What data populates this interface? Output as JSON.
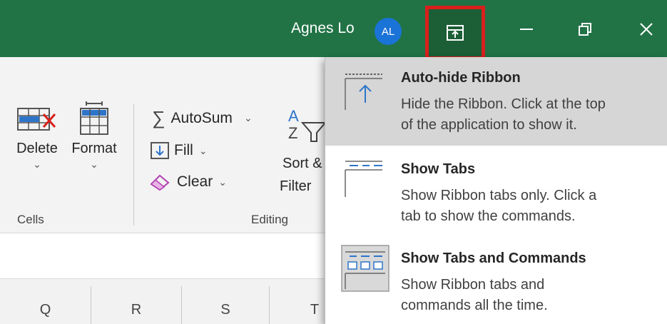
{
  "titlebar": {
    "user_name": "Agnes Lo",
    "avatar_initials": "AL",
    "colors": {
      "bar": "#217346",
      "avatar": "#1a73d6",
      "highlight_border": "#d9201c"
    },
    "icons": {
      "ribbon_options": "ribbon-display-options-icon",
      "minimize": "minimize-icon",
      "restore": "restore-icon",
      "close": "close-icon"
    }
  },
  "ribbon": {
    "cells_group": {
      "label": "Cells",
      "delete_label": "Delete",
      "format_label": "Format",
      "dropdown_glyph": "⌄"
    },
    "editing_group": {
      "label": "Editing",
      "autosum_label": "AutoSum",
      "autosum_glyph": "∑",
      "fill_label": "Fill",
      "clear_label": "Clear",
      "sort_filter_line1": "Sort &",
      "sort_filter_line2": "Filter",
      "caret": "⌄"
    }
  },
  "grid": {
    "columns": [
      "Q",
      "R",
      "S",
      "T"
    ]
  },
  "menu": {
    "items": [
      {
        "title": "Auto-hide Ribbon",
        "desc_line1": "Hide the Ribbon. Click at the top",
        "desc_line2": "of the application to show it.",
        "icon": "auto-hide-ribbon-icon",
        "active": true
      },
      {
        "title": "Show Tabs",
        "desc_line1": "Show Ribbon tabs only. Click a",
        "desc_line2": "tab to show the commands.",
        "icon": "show-tabs-icon",
        "active": false
      },
      {
        "title": "Show Tabs and Commands",
        "desc_line1": "Show Ribbon tabs and",
        "desc_line2": "commands all the time.",
        "icon": "show-tabs-commands-icon",
        "active": false
      }
    ]
  }
}
